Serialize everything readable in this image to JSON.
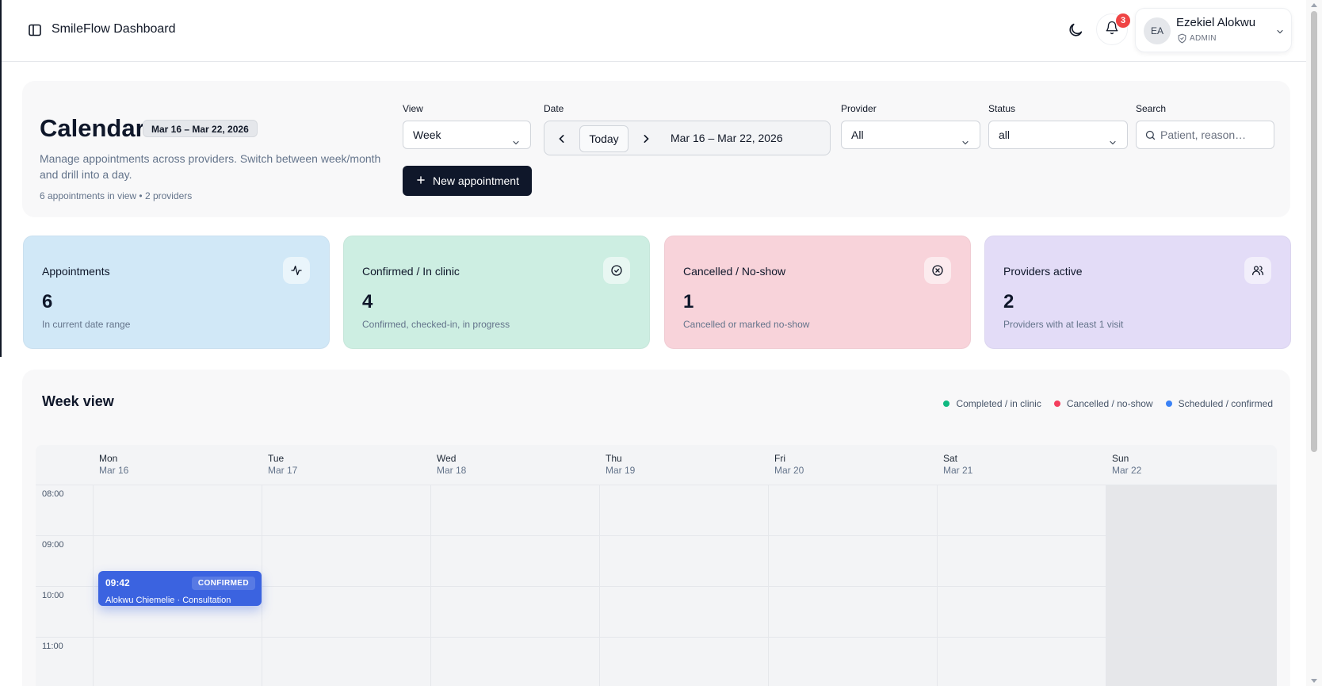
{
  "app": {
    "title": "SmileFlow Dashboard"
  },
  "topbar": {
    "notifications_count": "3",
    "user": {
      "initials": "EA",
      "name": "Ezekiel Alokwu",
      "role": "ADMIN"
    }
  },
  "header": {
    "title": "Calendar",
    "range_chip": "Mar 16 – Mar 22, 2026",
    "description": "Manage appointments across providers. Switch between week/month and drill into a day.",
    "meta": "6 appointments in view • 2 providers",
    "filters": {
      "view": {
        "label": "View",
        "value": "Week"
      },
      "date": {
        "label": "Date",
        "today_label": "Today",
        "range": "Mar 16 – Mar 22, 2026"
      },
      "provider": {
        "label": "Provider",
        "value": "All"
      },
      "status": {
        "label": "Status",
        "value": "all"
      },
      "search": {
        "label": "Search",
        "placeholder": "Patient, reason…"
      }
    },
    "new_button": "New appointment"
  },
  "stats": [
    {
      "label": "Appointments",
      "value": "6",
      "sub": "In current date range",
      "icon": "activity-icon",
      "bg": "#d1e8f7"
    },
    {
      "label": "Confirmed / In clinic",
      "value": "4",
      "sub": "Confirmed, checked-in, in progress",
      "icon": "check-circle-icon",
      "bg": "#cdeee2"
    },
    {
      "label": "Cancelled / No-show",
      "value": "1",
      "sub": "Cancelled or marked no-show",
      "icon": "x-circle-icon",
      "bg": "#f8d3da"
    },
    {
      "label": "Providers active",
      "value": "2",
      "sub": "Providers with at least 1 visit",
      "icon": "users-icon",
      "bg": "#e3dcf7"
    }
  ],
  "week": {
    "title": "Week view",
    "legend": [
      {
        "label": "Completed / in clinic",
        "color": "#10b981"
      },
      {
        "label": "Cancelled / no-show",
        "color": "#f43f5e"
      },
      {
        "label": "Scheduled / confirmed",
        "color": "#3b82f6"
      }
    ],
    "days": [
      {
        "name": "Mon",
        "date": "Mar 16"
      },
      {
        "name": "Tue",
        "date": "Mar 17"
      },
      {
        "name": "Wed",
        "date": "Mar 18"
      },
      {
        "name": "Thu",
        "date": "Mar 19"
      },
      {
        "name": "Fri",
        "date": "Mar 20"
      },
      {
        "name": "Sat",
        "date": "Mar 21"
      },
      {
        "name": "Sun",
        "date": "Mar 22"
      }
    ],
    "hours": [
      "08:00",
      "09:00",
      "10:00",
      "11:00"
    ],
    "appointment": {
      "time": "09:42",
      "status": "CONFIRMED",
      "description": "Alokwu Chiemelie · Consultation",
      "color": "#3b63e0"
    }
  }
}
